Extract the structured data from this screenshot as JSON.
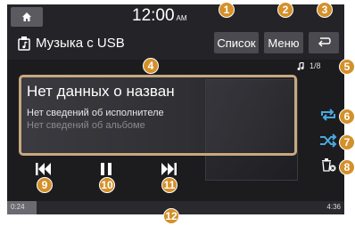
{
  "clock": {
    "time": "12:00",
    "ampm": "AM"
  },
  "header": {
    "source_title": "Музыка с USB"
  },
  "buttons": {
    "list": "Список",
    "menu": "Меню"
  },
  "track": {
    "counter": "1/8",
    "title": "Нет данных о назван",
    "artist": "Нет сведений об исполнителе",
    "album": "Нет сведений об альбоме"
  },
  "progress": {
    "elapsed": "0:24",
    "total": "4:36",
    "fraction": 0.087
  },
  "markers": [
    "1",
    "2",
    "3",
    "4",
    "5",
    "6",
    "7",
    "8",
    "9",
    "10",
    "11",
    "12"
  ],
  "colors": {
    "marker": "#d4902a",
    "highlight": "#c8a880"
  }
}
